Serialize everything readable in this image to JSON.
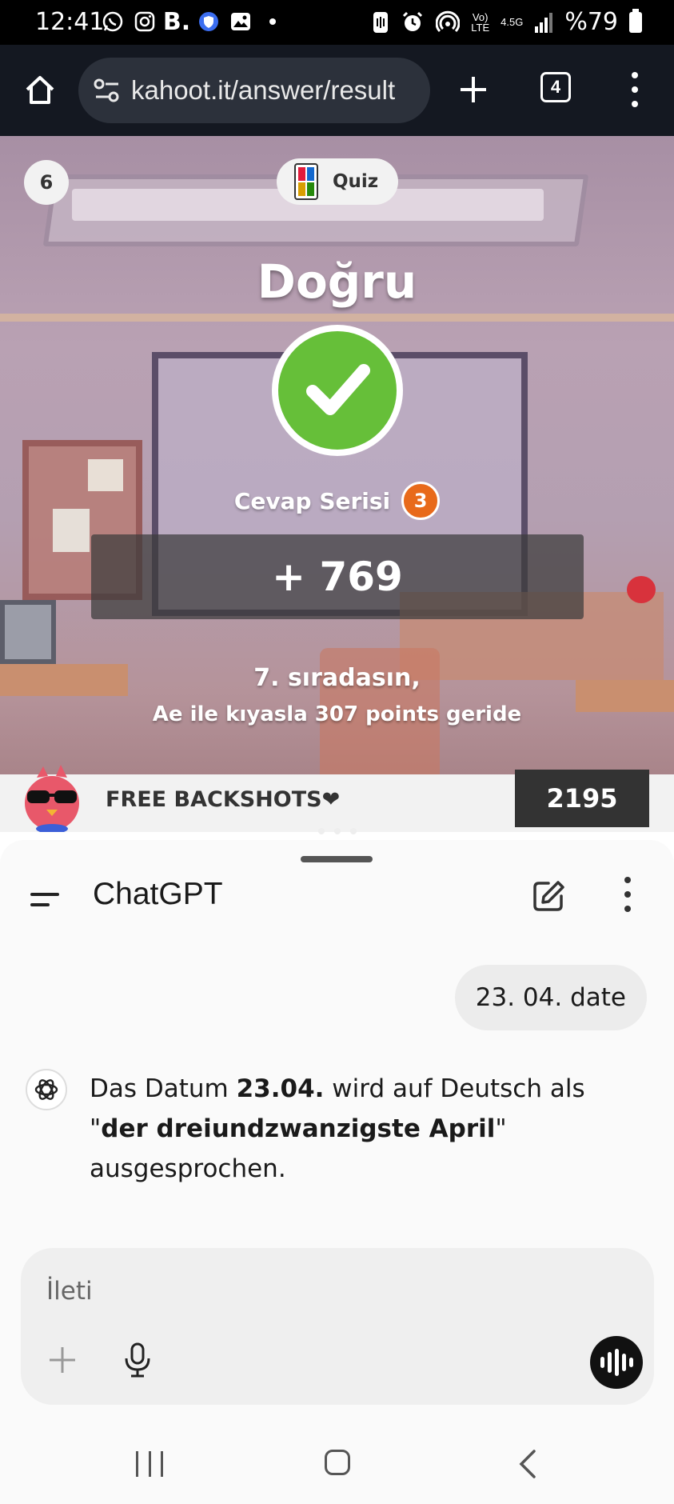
{
  "status_bar": {
    "time": "12:41",
    "left_icons": [
      "whatsapp-icon",
      "instagram-icon",
      "b-app-icon",
      "shield-icon",
      "gallery-icon",
      "dot-icon"
    ],
    "b_letter": "B.",
    "network_top": "Vo)",
    "network_bottom": "LTE",
    "data_type": "4.5G",
    "battery": "%79"
  },
  "browser": {
    "url": "kahoot.it/answer/result",
    "tab_count": "4"
  },
  "kahoot": {
    "question_number": "6",
    "quiz_label": "Quiz",
    "result": "Doğru",
    "streak_label": "Cevap Serisi",
    "streak_count": "3",
    "points_gained": "+ 769",
    "rank_text": "7. sıradasın,",
    "behind_text": "Ae ile kıyasla 307 points geride",
    "nickname": "FREE BACKSHOTS❤",
    "total_score": "2195"
  },
  "chat": {
    "title": "ChatGPT",
    "user_message": "23. 04. date",
    "assistant": {
      "part1": "Das Datum ",
      "bold1": "23.04.",
      "part2": " wird auf Deutsch als \"",
      "bold2": "der dreiundzwanzigste April",
      "part3": "\" ausgesprochen."
    },
    "input_placeholder": "İleti"
  },
  "colors": {
    "correct_green": "#66bf39",
    "streak_orange": "#e86a1b",
    "browser_bar": "#141821"
  }
}
